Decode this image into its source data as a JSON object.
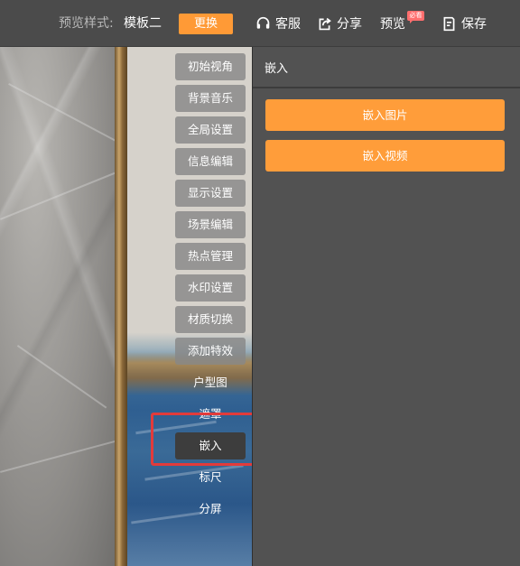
{
  "header": {
    "template_label": "预览样式:",
    "template_value": "模板二",
    "change_button": "更换",
    "service": "客服",
    "share": "分享",
    "preview": "预览",
    "preview_badge": "必看",
    "save": "保存"
  },
  "menu": {
    "items": [
      {
        "label": "初始视角",
        "state": "pill"
      },
      {
        "label": "背景音乐",
        "state": "pill"
      },
      {
        "label": "全局设置",
        "state": "pill"
      },
      {
        "label": "信息编辑",
        "state": "pill"
      },
      {
        "label": "显示设置",
        "state": "pill"
      },
      {
        "label": "场景编辑",
        "state": "pill"
      },
      {
        "label": "热点管理",
        "state": "pill"
      },
      {
        "label": "水印设置",
        "state": "pill"
      },
      {
        "label": "材质切换",
        "state": "pill"
      },
      {
        "label": "添加特效",
        "state": "pill"
      },
      {
        "label": "户型图",
        "state": "plain"
      },
      {
        "label": "遮罩",
        "state": "plain"
      },
      {
        "label": "嵌入",
        "state": "active"
      },
      {
        "label": "标尺",
        "state": "plain"
      },
      {
        "label": "分屏",
        "state": "plain"
      }
    ]
  },
  "panel": {
    "title": "嵌入",
    "embed_image_button": "嵌入图片",
    "embed_video_button": "嵌入视频"
  },
  "colors": {
    "accent": "#ff9d3a",
    "highlight": "#e23b3b"
  }
}
